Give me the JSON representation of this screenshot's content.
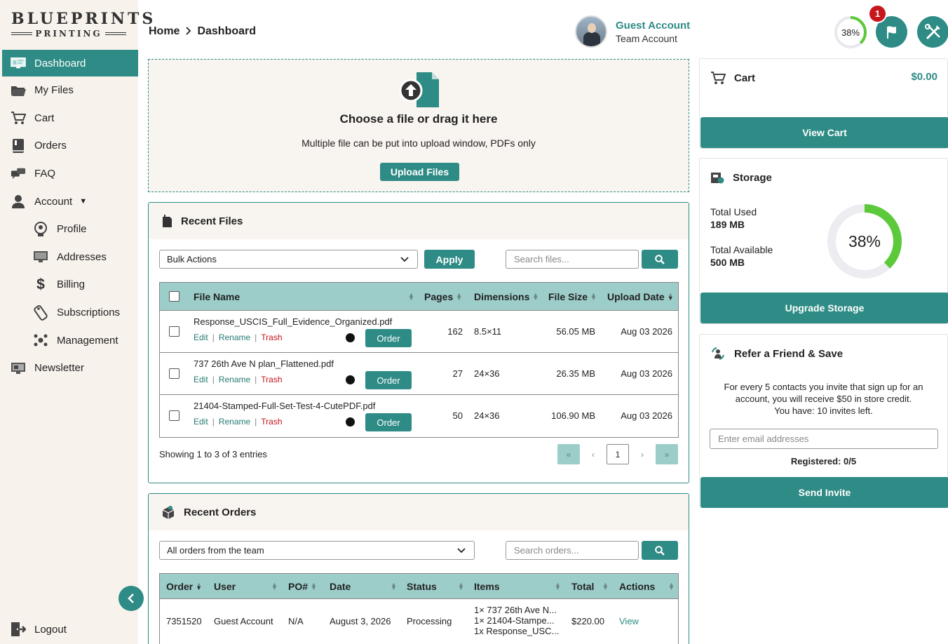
{
  "brand": {
    "line1": "BLUEPRINTS",
    "line2": "PRINTING"
  },
  "sidebar": {
    "items": [
      {
        "label": "Dashboard",
        "icon": "monitor-icon",
        "active": true
      },
      {
        "label": "My Files",
        "icon": "folder-icon"
      },
      {
        "label": "Cart",
        "icon": "cart-icon"
      },
      {
        "label": "Orders",
        "icon": "book-icon"
      },
      {
        "label": "FAQ",
        "icon": "chat-icon"
      },
      {
        "label": "Account",
        "icon": "user-icon",
        "expandable": true
      },
      {
        "label": "Profile",
        "icon": "profile-icon",
        "sub": true
      },
      {
        "label": "Addresses",
        "icon": "address-icon",
        "sub": true
      },
      {
        "label": "Billing",
        "icon": "dollar-icon",
        "sub": true
      },
      {
        "label": "Subscriptions",
        "icon": "tag-icon",
        "sub": true
      },
      {
        "label": "Management",
        "icon": "group-icon",
        "sub": true
      },
      {
        "label": "Newsletter",
        "icon": "newsletter-icon"
      }
    ],
    "logout_label": "Logout"
  },
  "header": {
    "breadcrumb": [
      "Home",
      "Dashboard"
    ],
    "user": {
      "name": "Guest Account",
      "role": "Team Account"
    },
    "storage_percent_label": "38%",
    "storage_percent": 38,
    "notification_count": "1"
  },
  "upload": {
    "title": "Choose a file or drag it here",
    "subtitle": "Multiple file can be put into upload window, PDFs only",
    "button": "Upload Files"
  },
  "recent_files": {
    "title": "Recent Files",
    "bulk_select": "Bulk Actions",
    "apply": "Apply",
    "search_placeholder": "Search files...",
    "columns": [
      "File Name",
      "Pages",
      "Dimensions",
      "File Size",
      "Upload Date"
    ],
    "actions": {
      "edit": "Edit",
      "rename": "Rename",
      "trash": "Trash",
      "order": "Order"
    },
    "rows": [
      {
        "name": "Response_USCIS_Full_Evidence_Organized.pdf",
        "pages": "162",
        "dimensions": "8.5×11",
        "size": "56.05 MB",
        "date": "Aug 03 2026"
      },
      {
        "name": "737 26th Ave N plan_Flattened.pdf",
        "pages": "27",
        "dimensions": "24×36",
        "size": "26.35 MB",
        "date": "Aug 03 2026"
      },
      {
        "name": "21404-Stamped-Full-Set-Test-4-CutePDF.pdf",
        "pages": "50",
        "dimensions": "24×36",
        "size": "106.90 MB",
        "date": "Aug 03 2026"
      }
    ],
    "showing": "Showing 1 to 3 of 3 entries",
    "pager": {
      "first": "«",
      "prev": "‹",
      "current": "1",
      "next": "›",
      "last": "»"
    }
  },
  "recent_orders": {
    "title": "Recent Orders",
    "filter": "All orders from the team",
    "search_placeholder": "Search orders...",
    "columns": [
      "Order",
      "User",
      "PO#",
      "Date",
      "Status",
      "Items",
      "Total",
      "Actions"
    ],
    "rows": [
      {
        "order": "7351520",
        "user": "Guest Account",
        "po": "N/A",
        "date": "August 3, 2026",
        "status": "Processing",
        "items": [
          "1× 737 26th Ave N...",
          "1× 21404-Stampe...",
          "1x Response_USC..."
        ],
        "total": "$220.00",
        "action": "View"
      }
    ]
  },
  "cart": {
    "title": "Cart",
    "amount": "$0.00",
    "button": "View Cart"
  },
  "storage": {
    "title": "Storage",
    "used_label": "Total Used",
    "used_value": "189 MB",
    "available_label": "Total Available",
    "available_value": "500 MB",
    "percent_label": "38%",
    "percent": 38,
    "button": "Upgrade Storage"
  },
  "refer": {
    "title": "Refer a Friend & Save",
    "text1": "For every 5 contacts you invite that sign up for an",
    "text2": "account, you will receive $50 in store credit.",
    "text3": "You have: 10 invites left.",
    "email_placeholder": "Enter email addresses",
    "registered": "Registered: 0/5",
    "button": "Send Invite"
  },
  "colors": {
    "teal": "#2e8b85",
    "teal_light": "#9ccdc9",
    "cream": "#f7f2ec",
    "trash_red": "#c0161d",
    "badge_red": "#c8161d",
    "gauge_green": "#5cc93a"
  }
}
